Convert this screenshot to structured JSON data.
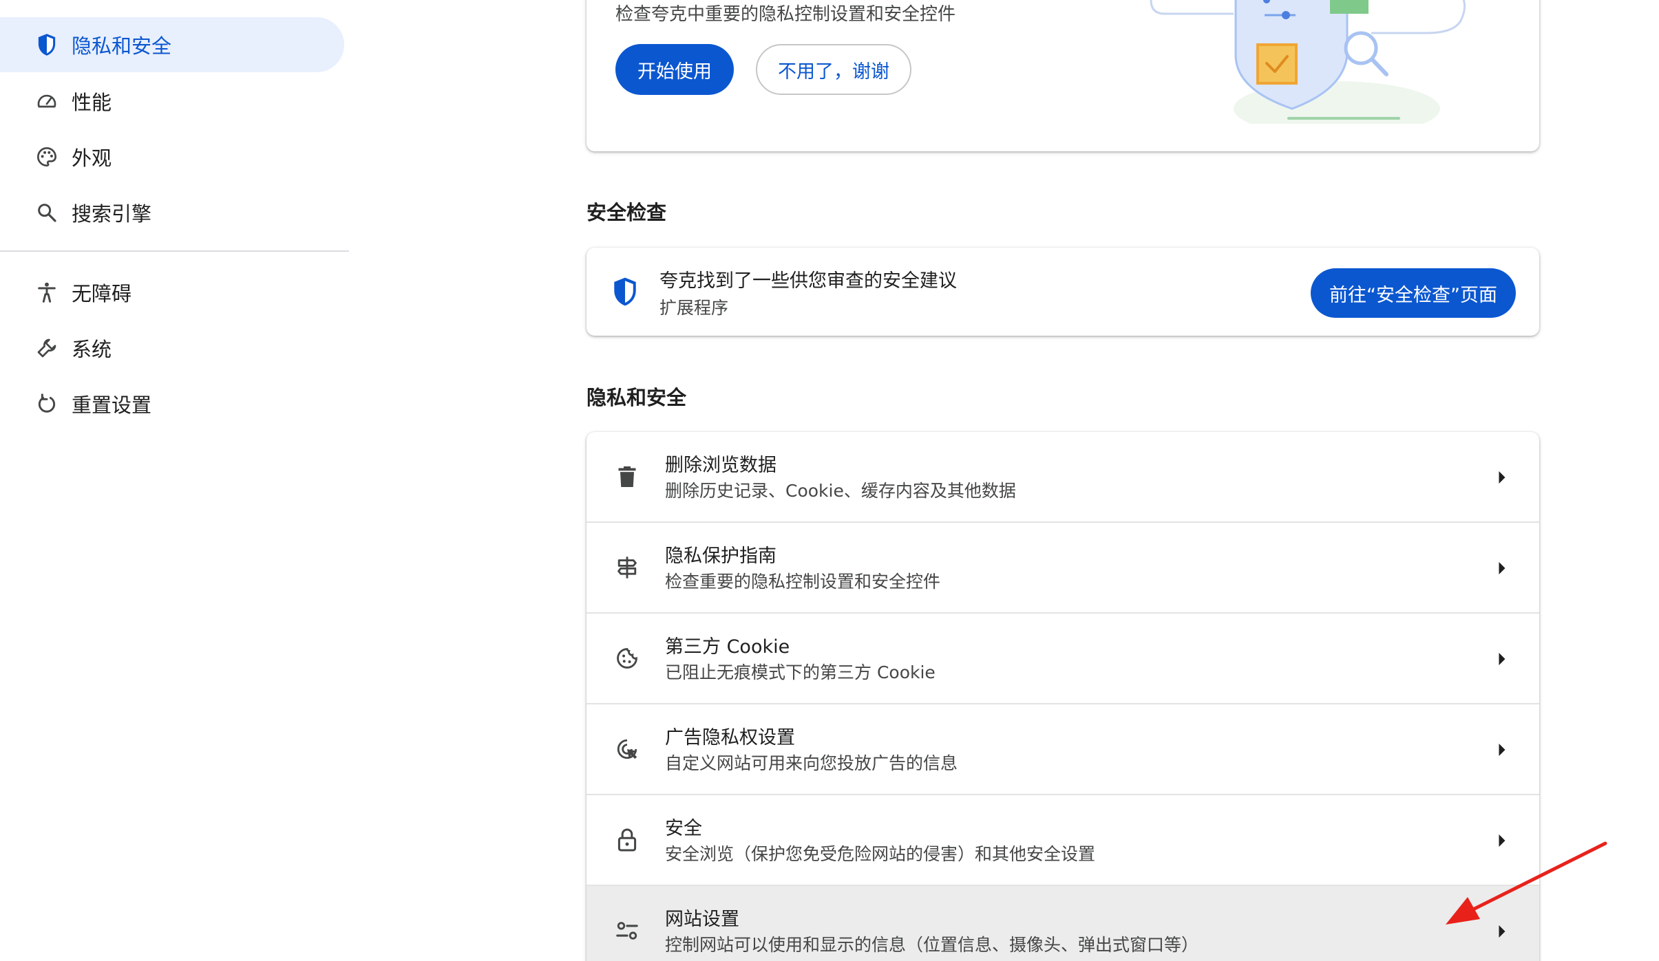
{
  "sidebar": {
    "items": [
      {
        "label": "隐私和安全",
        "icon": "shield-icon",
        "active": true
      },
      {
        "label": "性能",
        "icon": "speedometer-icon"
      },
      {
        "label": "外观",
        "icon": "palette-icon"
      },
      {
        "label": "搜索引擎",
        "icon": "search-icon"
      },
      {
        "label": "无障碍",
        "icon": "accessibility-icon"
      },
      {
        "label": "系统",
        "icon": "wrench-icon"
      },
      {
        "label": "重置设置",
        "icon": "reset-icon"
      }
    ]
  },
  "promo": {
    "description": "检查夸克中重要的隐私控制设置和安全控件",
    "start_label": "开始使用",
    "decline_label": "不用了，谢谢"
  },
  "safety_check": {
    "heading": "安全检查",
    "title": "夸克找到了一些供您审查的安全建议",
    "subtitle": "扩展程序",
    "button_label": "前往“安全检查”页面"
  },
  "privacy": {
    "heading": "隐私和安全",
    "rows": [
      {
        "title": "删除浏览数据",
        "subtitle": "删除历史记录、Cookie、缓存内容及其他数据",
        "icon": "trash-icon"
      },
      {
        "title": "隐私保护指南",
        "subtitle": "检查重要的隐私控制设置和安全控件",
        "icon": "privacy-guide-icon"
      },
      {
        "title": "第三方 Cookie",
        "subtitle": "已阻止无痕模式下的第三方 Cookie",
        "icon": "cookie-icon"
      },
      {
        "title": "广告隐私权设置",
        "subtitle": "自定义网站可用来向您投放广告的信息",
        "icon": "ad-privacy-icon"
      },
      {
        "title": "安全",
        "subtitle": "安全浏览（保护您免受危险网站的侵害）和其他安全设置",
        "icon": "lock-icon"
      },
      {
        "title": "网站设置",
        "subtitle": "控制网站可以使用和显示的信息（位置信息、摄像头、弹出式窗口等）",
        "icon": "site-settings-icon",
        "highlighted": true
      }
    ]
  },
  "colors": {
    "accent": "#0b57d0",
    "active_bg": "#e8effd",
    "annotation": "#e8221b"
  }
}
